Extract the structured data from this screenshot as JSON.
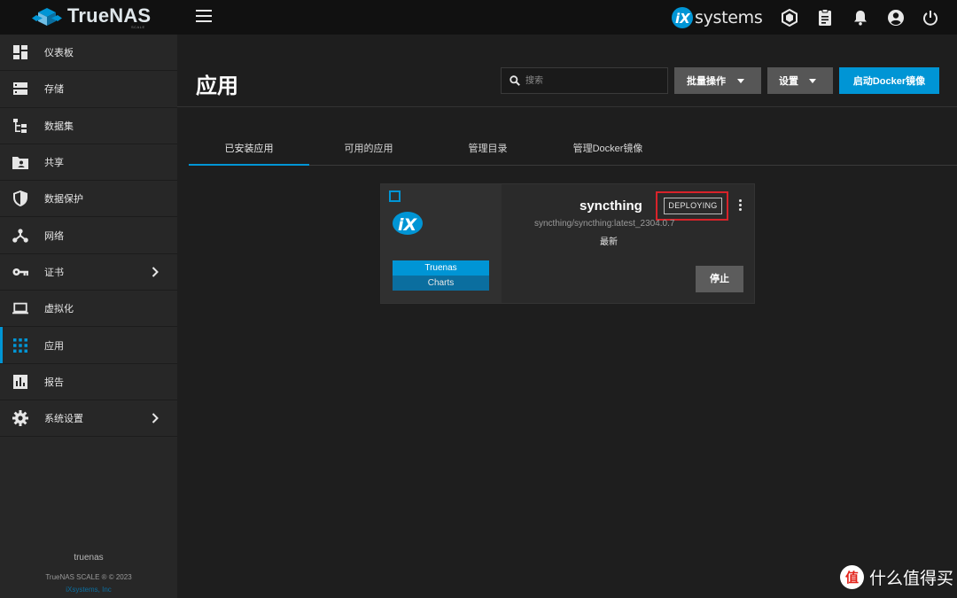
{
  "topbar": {
    "logo_text": "TrueNAS",
    "logo_sub": "SCALE",
    "brand_text": "systems",
    "icons": [
      "menu-icon",
      "truecommand-icon",
      "clipboard-icon",
      "bell-icon",
      "account-circle-icon",
      "power-icon"
    ]
  },
  "sidebar": {
    "items": [
      {
        "label": "仪表板",
        "icon": "dashboard-icon"
      },
      {
        "label": "存储",
        "icon": "storage-icon"
      },
      {
        "label": "数据集",
        "icon": "dataset-icon"
      },
      {
        "label": "共享",
        "icon": "shared-folder-icon"
      },
      {
        "label": "数据保护",
        "icon": "shield-icon"
      },
      {
        "label": "网络",
        "icon": "network-icon"
      },
      {
        "label": "证书",
        "icon": "key-icon"
      },
      {
        "label": "虚拟化",
        "icon": "laptop-icon"
      },
      {
        "label": "应用",
        "icon": "apps-grid-icon"
      },
      {
        "label": "报告",
        "icon": "chart-icon"
      },
      {
        "label": "系统设置",
        "icon": "gear-icon"
      }
    ],
    "active_index": 8,
    "footer_host": "truenas",
    "footer_copy": "TrueNAS SCALE ® © 2023",
    "footer_company": "iXsystems, Inc"
  },
  "main": {
    "title": "应用",
    "search_placeholder": "搜索",
    "bulk_button": "批量操作",
    "settings_button": "设置",
    "launch_button": "启动Docker镜像",
    "tabs": [
      "已安装应用",
      "可用的应用",
      "管理目录",
      "管理Docker镜像"
    ],
    "active_tab": 0
  },
  "app_card": {
    "name": "syncthing",
    "status": "DEPLOYING",
    "image": "syncthing/syncthing:latest_2304.0.7",
    "update_state": "最新",
    "catalog_line1": "Truenas",
    "catalog_line2": "Charts",
    "stop_button": "停止"
  },
  "watermark": {
    "mark": "值",
    "text": "什么值得买"
  },
  "colors": {
    "accent": "#0095d5",
    "highlight_box": "#d8232a",
    "topbar": "#111111",
    "sidebar": "#272727",
    "background": "#1e1e1e"
  }
}
